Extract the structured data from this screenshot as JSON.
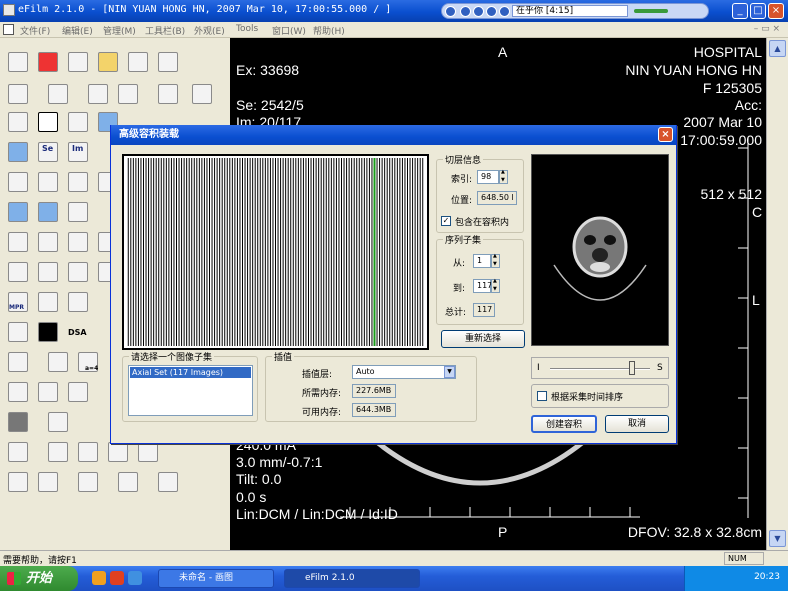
{
  "window": {
    "title": "eFilm 2.1.0 - [NIN YUAN HONG HN, 2007 Mar 10, 17:00:55.000  /  ]"
  },
  "media_player": {
    "now_playing": "在乎你 [4:15]"
  },
  "menu": {
    "items": [
      "文件(F)",
      "编辑(E)",
      "管理(M)",
      "工具栏(B)",
      "外观(E)",
      "Tools",
      "窗口(W)",
      "帮助(H)"
    ]
  },
  "toolbar": {
    "se_label": "Se",
    "im_label": "Im",
    "dsa_label": "DSA",
    "mpr_label": "MPR",
    "a4_label": "a=4"
  },
  "viewer": {
    "top_left": [
      "Ex: 33698",
      "Se: 2542/5",
      "Im: 20/117"
    ],
    "top_center": "A",
    "top_right": [
      "HOSPITAL",
      "NIN YUAN HONG HN",
      "F  125305",
      "Acc:",
      "2007 Mar 10",
      "17:00:59.000"
    ],
    "matrix": "512 x 512",
    "right_mark_c": "C",
    "right_mark_l": "L",
    "bottom_left": [
      "240.0 mA",
      "3.0 mm/-0.7:1",
      "Tilt: 0.0",
      "0.0 s",
      "Lin:DCM / Lin:DCM / Id:ID"
    ],
    "bottom_center": "P",
    "bottom_right": "DFOV: 32.8 x 32.8cm"
  },
  "status_bar": {
    "help_text": "需要帮助，请按F1",
    "num_indicator": "NUM"
  },
  "taskbar": {
    "start_label": "开始",
    "tasks": [
      "未命名 - 画图",
      "eFilm 2.1.0"
    ],
    "clock": "20:23"
  },
  "dialog": {
    "title": "高级容积装载",
    "slice_group": {
      "title": "切层信息",
      "index_label": "索引:",
      "index_value": "98",
      "position_label": "位置:",
      "position_value": "648.50 l",
      "include_label": "包含在容积内",
      "include_checked": true
    },
    "series_group": {
      "title": "序列子集",
      "from_label": "从:",
      "from_value": "1",
      "to_label": "到:",
      "to_value": "117",
      "total_label": "总计:",
      "total_value": "117",
      "reselect_button": "重新选择"
    },
    "subset_group": {
      "title": "请选择一个图像子集",
      "items": [
        "Axial Set (117 Images)"
      ]
    },
    "interp_group": {
      "title": "插值",
      "layer_label": "插值层:",
      "layer_value": "Auto",
      "mem_needed_label": "所需内存:",
      "mem_needed_value": "227.6MB",
      "mem_avail_label": "可用内存:",
      "mem_avail_value": "644.3MB"
    },
    "slider": {
      "left_label": "I",
      "right_label": "S",
      "level": 0.82
    },
    "sort_label": "根据采集时间排序",
    "sort_checked": false,
    "create_button": "创建容积",
    "cancel_button": "取消",
    "preview": {
      "slice_count": 117,
      "selected_slice": 98
    },
    "colors": {
      "highlight_line": "#1a9a1a",
      "selection": "#316ac5"
    }
  }
}
